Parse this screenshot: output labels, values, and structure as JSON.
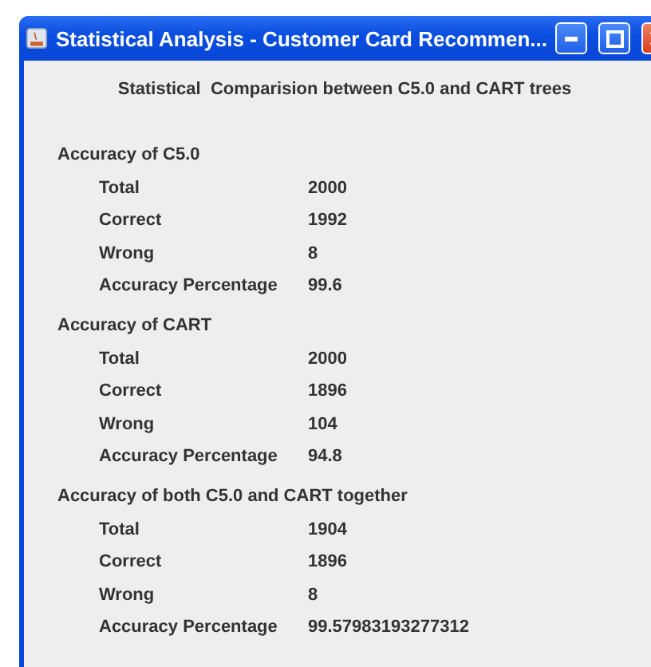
{
  "window": {
    "title": "Statistical Analysis - Customer Card Recommen..."
  },
  "heading": "Statistical  Comparision between C5.0 and CART trees",
  "sections": [
    {
      "title": "Accuracy of C5.0",
      "rows": [
        {
          "label": "Total",
          "value": "2000"
        },
        {
          "label": "Correct",
          "value": "1992"
        },
        {
          "label": "Wrong",
          "value": "8"
        },
        {
          "label": "Accuracy Percentage",
          "value": "99.6"
        }
      ]
    },
    {
      "title": "Accuracy of CART",
      "rows": [
        {
          "label": "Total",
          "value": "2000"
        },
        {
          "label": "Correct",
          "value": "1896"
        },
        {
          "label": "Wrong",
          "value": "104"
        },
        {
          "label": "Accuracy Percentage",
          "value": "94.8"
        }
      ]
    },
    {
      "title": "Accuracy of both C5.0 and CART together",
      "rows": [
        {
          "label": "Total",
          "value": "1904"
        },
        {
          "label": "Correct",
          "value": "1896"
        },
        {
          "label": "Wrong",
          "value": "8"
        },
        {
          "label": "Accuracy Percentage",
          "value": "99.57983193277312"
        }
      ]
    }
  ]
}
